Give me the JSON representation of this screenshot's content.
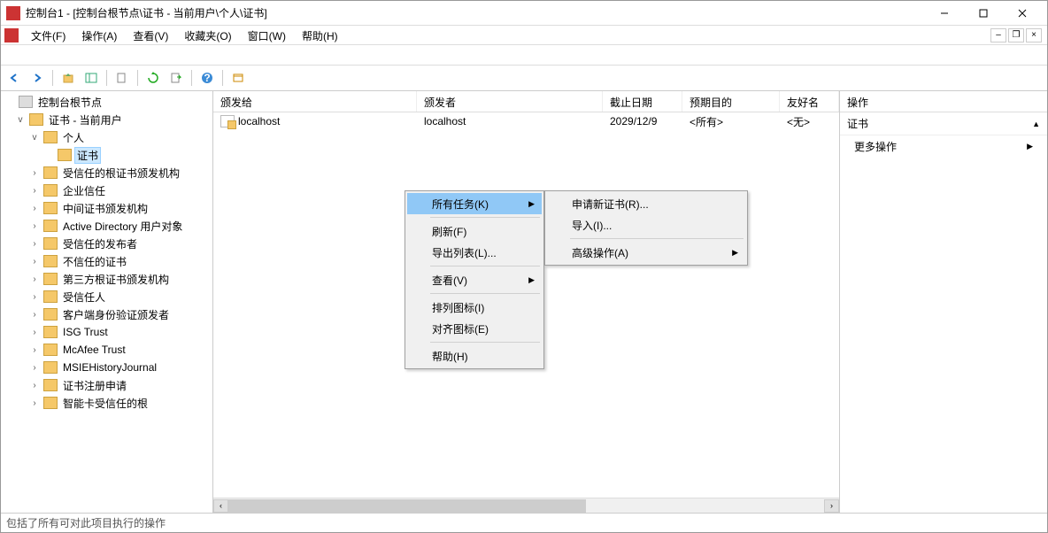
{
  "window": {
    "title": "控制台1 - [控制台根节点\\证书 - 当前用户\\个人\\证书]"
  },
  "menubar": {
    "file": "文件(F)",
    "action": "操作(A)",
    "view": "查看(V)",
    "favorites": "收藏夹(O)",
    "window": "窗口(W)",
    "help": "帮助(H)"
  },
  "tree": {
    "root": "控制台根节点",
    "certs_user": "证书 - 当前用户",
    "personal": "个人",
    "certificates": "证书",
    "nodes": [
      "受信任的根证书颁发机构",
      "企业信任",
      "中间证书颁发机构",
      "Active Directory 用户对象",
      "受信任的发布者",
      "不信任的证书",
      "第三方根证书颁发机构",
      "受信任人",
      "客户端身份验证颁发者",
      "ISG Trust",
      "McAfee Trust",
      "MSIEHistoryJournal",
      "证书注册申请",
      "智能卡受信任的根"
    ]
  },
  "list": {
    "columns": {
      "issued_to": "颁发给",
      "issued_by": "颁发者",
      "exp_date": "截止日期",
      "purpose": "预期目的",
      "friendly": "友好名"
    },
    "row": {
      "issued_to": "localhost",
      "issued_by": "localhost",
      "exp_date": "2029/12/9",
      "purpose": "<所有>",
      "friendly": "<无>"
    }
  },
  "actions": {
    "header": "操作",
    "title": "证书",
    "more": "更多操作"
  },
  "context1": {
    "all_tasks": "所有任务(K)",
    "refresh": "刷新(F)",
    "export_list": "导出列表(L)...",
    "view": "查看(V)",
    "arrange": "排列图标(I)",
    "align": "对齐图标(E)",
    "help": "帮助(H)"
  },
  "context2": {
    "request_new": "申请新证书(R)...",
    "import": "导入(I)...",
    "advanced": "高级操作(A)"
  },
  "statusbar": "包括了所有可对此项目执行的操作"
}
